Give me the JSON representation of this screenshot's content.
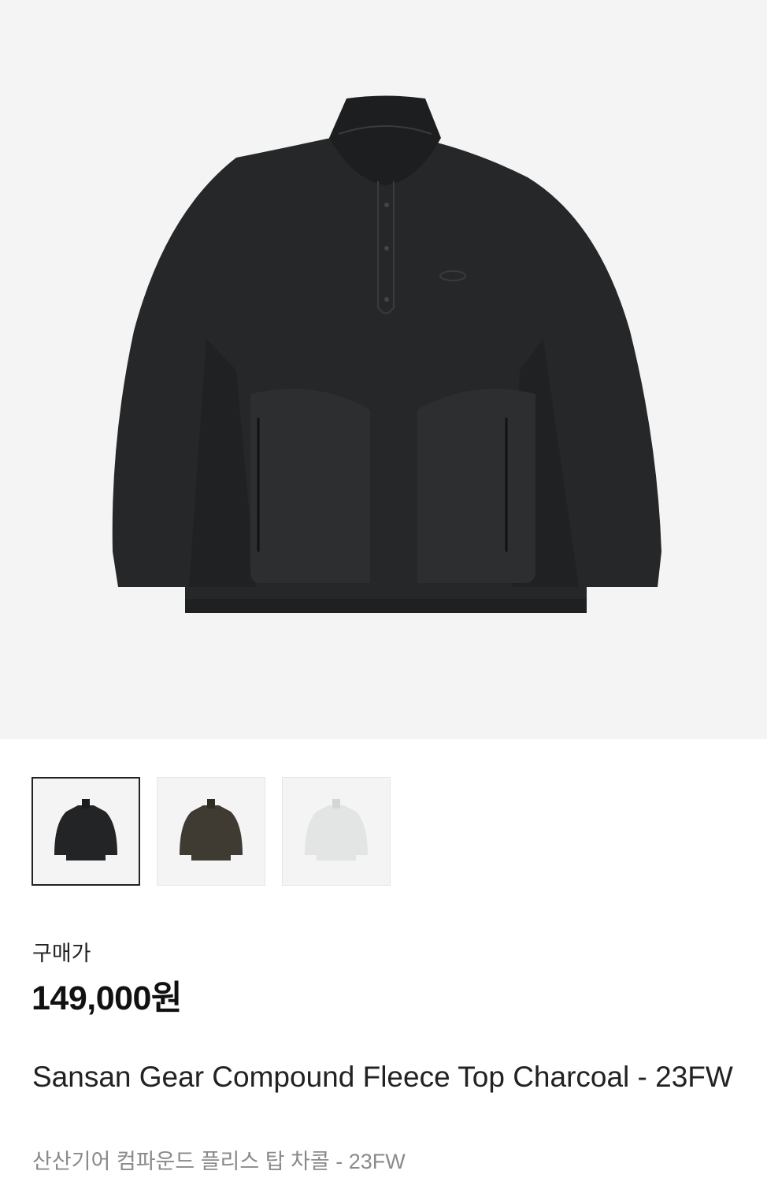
{
  "product": {
    "main_image_icon": "fleece-top-charcoal-image",
    "thumbnails": [
      {
        "name": "thumbnail-charcoal",
        "color": "#232425",
        "selected": true
      },
      {
        "name": "thumbnail-brown",
        "color": "#3f3a32",
        "selected": false
      },
      {
        "name": "thumbnail-light-gray",
        "color": "#e3e4e4",
        "selected": false
      }
    ],
    "price_label": "구매가",
    "price": "149,000원",
    "title_en": "Sansan Gear Compound Fleece Top Charcoal - 23FW",
    "title_ko": "산산기어 컴파운드 플리스 탑 차콜 - 23FW"
  },
  "colors": {
    "hero_background": "#f4f4f4",
    "selected_border": "#222222",
    "subtitle_gray": "#8a8a8a"
  }
}
